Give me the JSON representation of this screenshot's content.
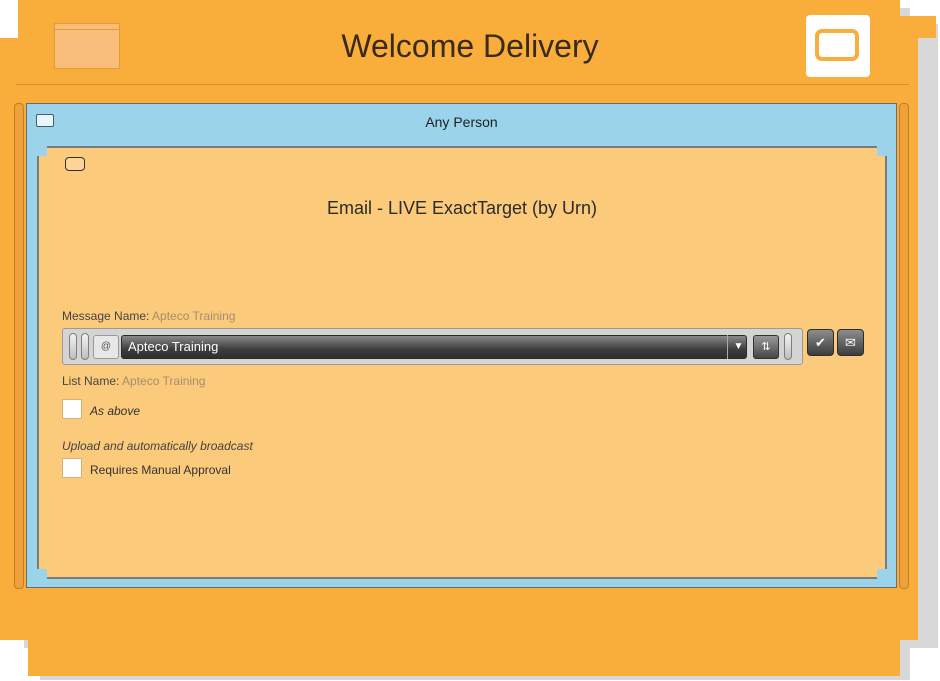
{
  "header": {
    "title": "Welcome Delivery"
  },
  "person_panel": {
    "title": "Any Person"
  },
  "channel": {
    "title": "Email - LIVE ExactTarget (by Urn)",
    "message_name_label": "Message Name:",
    "message_name_value": "Apteco Training",
    "select_at_symbol": "@",
    "selected_message": "Apteco Training",
    "list_name_label": "List Name:",
    "list_name_value": "Apteco Training",
    "as_above_label": "As above",
    "upload_note": "Upload and automatically broadcast",
    "requires_approval_label": "Requires Manual Approval"
  },
  "colors": {
    "frame_orange": "#f9ad3a",
    "panel_blue": "#9ad3ea",
    "panel_peach": "#fbca7b"
  },
  "icons": {
    "refresh": "refresh-icon",
    "confirm": "checkmark-icon",
    "email": "envelope-icon",
    "dropdown": "chevron-down-icon"
  }
}
